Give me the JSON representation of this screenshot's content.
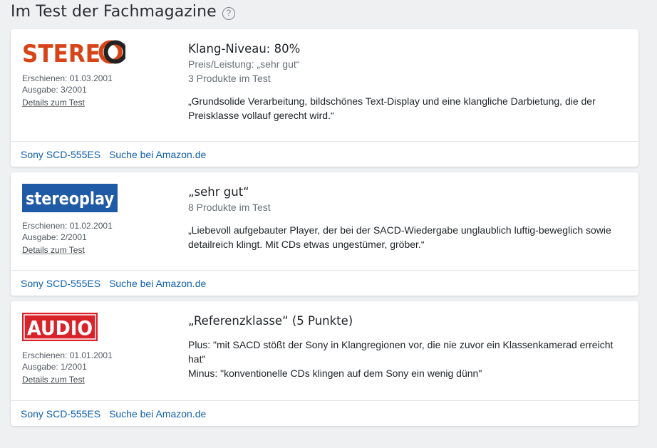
{
  "page": {
    "title": "Im Test der Fachmagazine",
    "help_icon": "question-circle-icon"
  },
  "reviews": [
    {
      "magazine": "STEREO",
      "logo_color": "#d64418",
      "published": "Erschienen: 01.03.2001",
      "issue": "Ausgabe: 3/2001",
      "details_label": "Details zum Test",
      "headline": "Klang-Niveau: 80%",
      "sub_lines": [
        "Preis/Leistung: „sehr gut“",
        "3 Produkte im Test"
      ],
      "quote_lines": [
        "„Grundsolide Verarbeitung, bildschönes Text-Display und eine klangliche Darbietung, die der",
        "Preisklasse vollauf gerecht wird.“"
      ],
      "product_link": "Sony SCD-555ES",
      "amazon_link": "Suche bei Amazon.de"
    },
    {
      "magazine": "stereoplay",
      "logo_color": "#1f5aa6",
      "published": "Erschienen: 01.02.2001",
      "issue": "Ausgabe: 2/2001",
      "details_label": "Details zum Test",
      "headline": "„sehr gut“",
      "sub_lines": [
        "8 Produkte im Test"
      ],
      "quote_lines": [
        "„Liebevoll aufgebauter Player, der bei der SACD-Wiedergabe unglaublich luftig-beweglich sowie",
        "detailreich klingt. Mit CDs etwas ungestümer, gröber.“"
      ],
      "product_link": "Sony SCD-555ES",
      "amazon_link": "Suche bei Amazon.de"
    },
    {
      "magazine": "AUDIO",
      "logo_color": "#d9232a",
      "published": "Erschienen: 01.01.2001",
      "issue": "Ausgabe: 1/2001",
      "details_label": "Details zum Test",
      "headline": "„Referenzklasse“ (5 Punkte)",
      "sub_lines": [],
      "quote_lines": [
        "Plus: \"mit SACD stößt der Sony in Klangregionen vor, die nie zuvor ein Klassenkamerad erreicht",
        "hat\"",
        "Minus: \"konventionelle CDs klingen auf dem Sony ein wenig dünn\""
      ],
      "product_link": "Sony SCD-555ES",
      "amazon_link": "Suche bei Amazon.de"
    }
  ]
}
